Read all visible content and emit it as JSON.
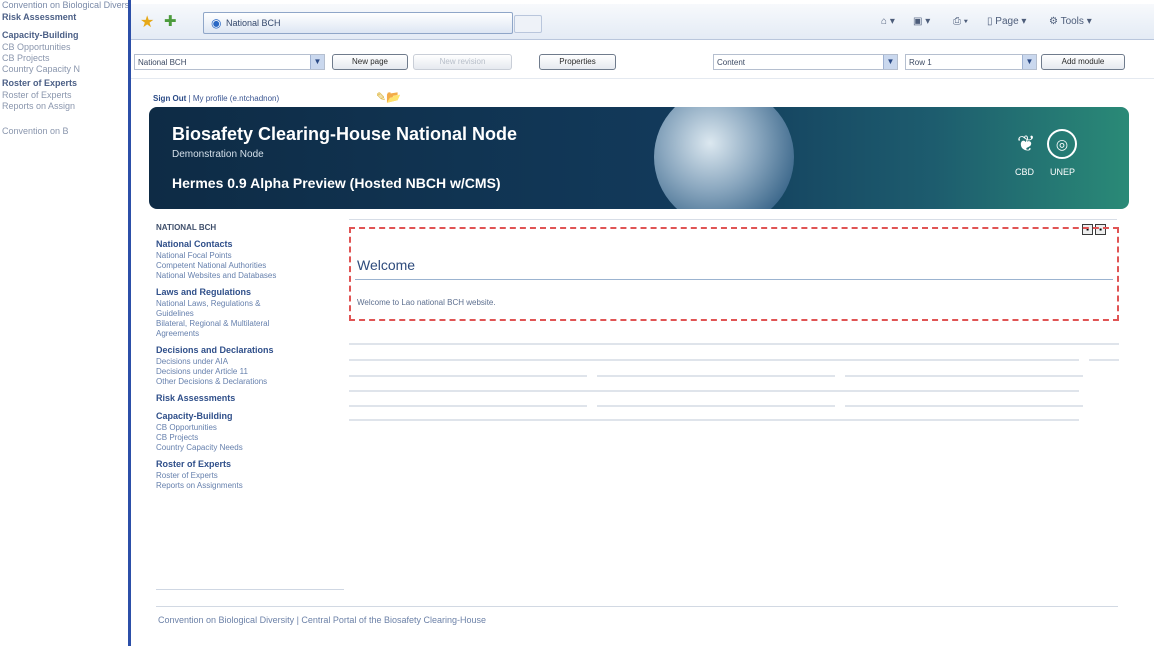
{
  "background_window": {
    "top_link": "Convention on Biological Diversity",
    "items": [
      {
        "label": "Risk Assessment",
        "head": true
      },
      {
        "label": "Capacity-Building",
        "head": true
      },
      {
        "label": "CB Opportunities",
        "head": false
      },
      {
        "label": "CB Projects",
        "head": false
      },
      {
        "label": "Country Capacity N",
        "head": false
      },
      {
        "label": "Roster of Experts",
        "head": true
      },
      {
        "label": "Roster of Experts",
        "head": false
      },
      {
        "label": "Reports on Assign",
        "head": false
      },
      {
        "label": "Convention on B",
        "head": false
      }
    ]
  },
  "browser": {
    "tab_title": "National BCH",
    "toolbar": {
      "page_label": "Page",
      "tools_label": "Tools"
    }
  },
  "admin_bar": {
    "site_select": "National BCH",
    "new_page": "New page",
    "new_revision": "New revision",
    "properties": "Properties",
    "content_select": "Content",
    "row_select": "Row 1",
    "add_module": "Add module"
  },
  "page": {
    "signout": "Sign Out",
    "separator": "|",
    "profile": "My profile",
    "user": "(e.ntchadnon)",
    "banner": {
      "title": "Biosafety Clearing-House National Node",
      "subtitle": "Demonstration Node",
      "preview": "Hermes 0.9 Alpha Preview (Hosted NBCH w/CMS)",
      "cbd": "CBD",
      "unep": "UNEP"
    },
    "nav": {
      "top": "NATIONAL BCH",
      "sections": [
        {
          "head": "National Contacts",
          "items": [
            "National Focal Points",
            "Competent National Authorities",
            "National Websites and Databases"
          ]
        },
        {
          "head": "Laws and Regulations",
          "items": [
            "National Laws, Regulations &",
            "Guidelines",
            "Bilateral, Regional & Multilateral",
            "Agreements"
          ]
        },
        {
          "head": "Decisions and Declarations",
          "items": [
            "Decisions under AIA",
            "Decisions under Article 11",
            "Other Decisions & Declarations"
          ]
        },
        {
          "head": "Risk Assessments",
          "items": []
        },
        {
          "head": "Capacity-Building",
          "items": [
            "CB Opportunities",
            "CB Projects",
            "Country Capacity Needs"
          ]
        },
        {
          "head": "Roster of Experts",
          "items": [
            "Roster of Experts",
            "Reports on Assignments"
          ]
        }
      ]
    },
    "welcome": {
      "title": "Welcome",
      "text": "Welcome to Lao national BCH website."
    },
    "footer": "Convention on Biological Diversity | Central Portal of the Biosafety Clearing-House"
  }
}
